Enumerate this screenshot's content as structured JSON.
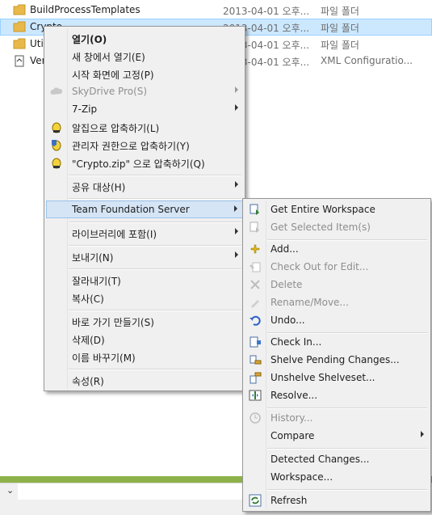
{
  "files": [
    {
      "name": "BuildProcessTemplates",
      "date": "",
      "type": "파일 폴더",
      "icon": "folder-icon"
    },
    {
      "name": "Crypto",
      "date": "2013-04-01 오후...",
      "type": "파일 폴더",
      "icon": "folder-icon"
    },
    {
      "name": "Util",
      "date": "2013-04-01 오후...",
      "type": "파일 폴더",
      "icon": "folder-icon"
    },
    {
      "name": "Ver",
      "date": "2013-04-01 오후...",
      "type": "XML Configuratio...",
      "icon": "xml-file-icon"
    }
  ],
  "files_dates": {
    "row0": "2013-04-01 오후...",
    "row2": "2013-04-01 오후..."
  },
  "context_menu": {
    "open": "열기(O)",
    "open_new_window": "새 창에서 열기(E)",
    "pin_start": "시작 화면에 고정(P)",
    "skydrive": "SkyDrive Pro(S)",
    "sevenzip": "7-Zip",
    "alzip_compress": "알집으로 압축하기(L)",
    "admin_compress": "관리자 권한으로 압축하기(Y)",
    "compress_named": "\"Crypto.zip\" 으로 압축하기(Q)",
    "share_with": "공유 대상(H)",
    "tfs": "Team Foundation Server",
    "include_library": "라이브러리에 포함(I)",
    "send_to": "보내기(N)",
    "cut": "잘라내기(T)",
    "copy": "복사(C)",
    "create_shortcut": "바로 가기 만들기(S)",
    "delete": "삭제(D)",
    "rename": "이름 바꾸기(M)",
    "properties": "속성(R)"
  },
  "tfs_menu": {
    "get_entire_workspace": "Get Entire Workspace",
    "get_selected_items": "Get Selected Item(s)",
    "add": "Add...",
    "check_out": "Check Out for Edit...",
    "delete": "Delete",
    "rename_move": "Rename/Move...",
    "undo": "Undo...",
    "check_in": "Check In...",
    "shelve": "Shelve Pending Changes...",
    "unshelve": "Unshelve Shelveset...",
    "resolve": "Resolve...",
    "history": "History...",
    "compare": "Compare",
    "detected_changes": "Detected Changes...",
    "workspace": "Workspace...",
    "refresh": "Refresh"
  },
  "colors": {
    "selection": "#cce8ff",
    "menu_bg": "#f0f0f0",
    "hover": "#d5e5f6",
    "accent_green": "#8eb24a",
    "folder": "#e8b84a"
  }
}
